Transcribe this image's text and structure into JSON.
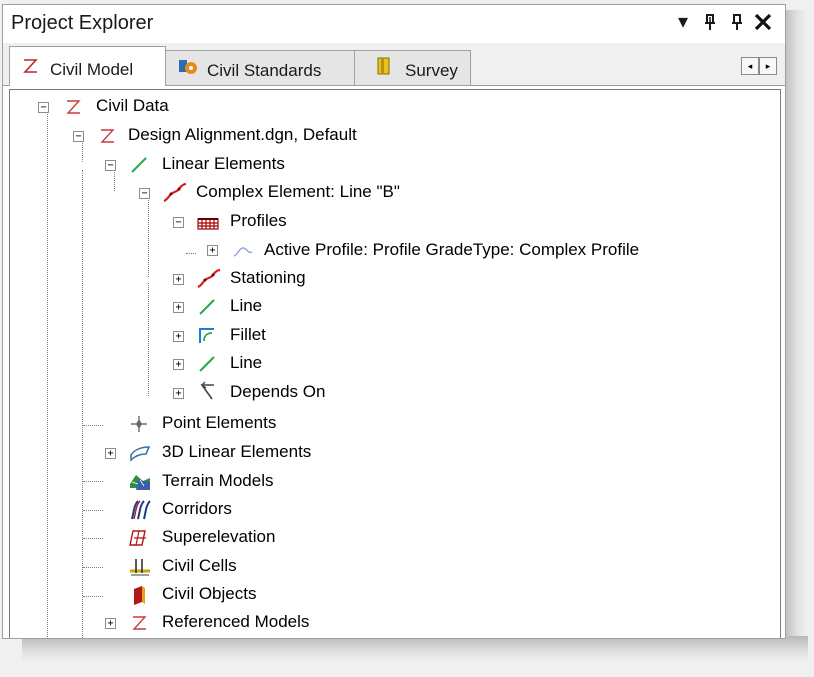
{
  "panel": {
    "title": "Project Explorer",
    "buttons": {
      "dropdown": "▾",
      "dock": "⊕",
      "pin": "ꟼ",
      "close": "✕"
    }
  },
  "tabs": [
    {
      "label": "Civil Model",
      "icon": "civil-model-icon",
      "active": true
    },
    {
      "label": "Civil Standards",
      "icon": "civil-standards-icon",
      "active": false
    },
    {
      "label": "Survey",
      "icon": "survey-icon",
      "active": false
    }
  ],
  "tab_scroll": {
    "left": "◂",
    "right": "▸"
  },
  "tree": {
    "nodes": [
      {
        "label": "Civil Data",
        "icon": "civil-data-icon",
        "toggle": "−"
      },
      {
        "label": "Design Alignment.dgn, Default",
        "icon": "civil-data-icon",
        "toggle": "−"
      },
      {
        "label": "Linear Elements",
        "icon": "linear-elements-icon",
        "toggle": "−"
      },
      {
        "label": "Complex Element: Line \"B\"",
        "icon": "complex-element-icon",
        "toggle": "−"
      },
      {
        "label": "Profiles",
        "icon": "profiles-icon",
        "toggle": "−"
      },
      {
        "label": "Active Profile: Profile GradeType: Complex Profile",
        "icon": "active-profile-icon",
        "toggle": "+"
      },
      {
        "label": "Stationing",
        "icon": "stationing-icon",
        "toggle": "+"
      },
      {
        "label": "Line",
        "icon": "line-icon",
        "toggle": "+"
      },
      {
        "label": "Fillet",
        "icon": "fillet-icon",
        "toggle": "+"
      },
      {
        "label": "Line",
        "icon": "line-icon",
        "toggle": "+"
      },
      {
        "label": "Depends On",
        "icon": "depends-on-icon",
        "toggle": "+"
      },
      {
        "label": "Point Elements",
        "icon": "point-elements-icon",
        "toggle": ""
      },
      {
        "label": "3D Linear Elements",
        "icon": "3d-linear-elements-icon",
        "toggle": "+"
      },
      {
        "label": "Terrain Models",
        "icon": "terrain-models-icon",
        "toggle": ""
      },
      {
        "label": "Corridors",
        "icon": "corridors-icon",
        "toggle": ""
      },
      {
        "label": "Superelevation",
        "icon": "superelevation-icon",
        "toggle": ""
      },
      {
        "label": "Civil Cells",
        "icon": "civil-cells-icon",
        "toggle": ""
      },
      {
        "label": "Civil Objects",
        "icon": "civil-objects-icon",
        "toggle": ""
      },
      {
        "label": "Referenced Models",
        "icon": "referenced-models-icon",
        "toggle": "+"
      }
    ]
  }
}
